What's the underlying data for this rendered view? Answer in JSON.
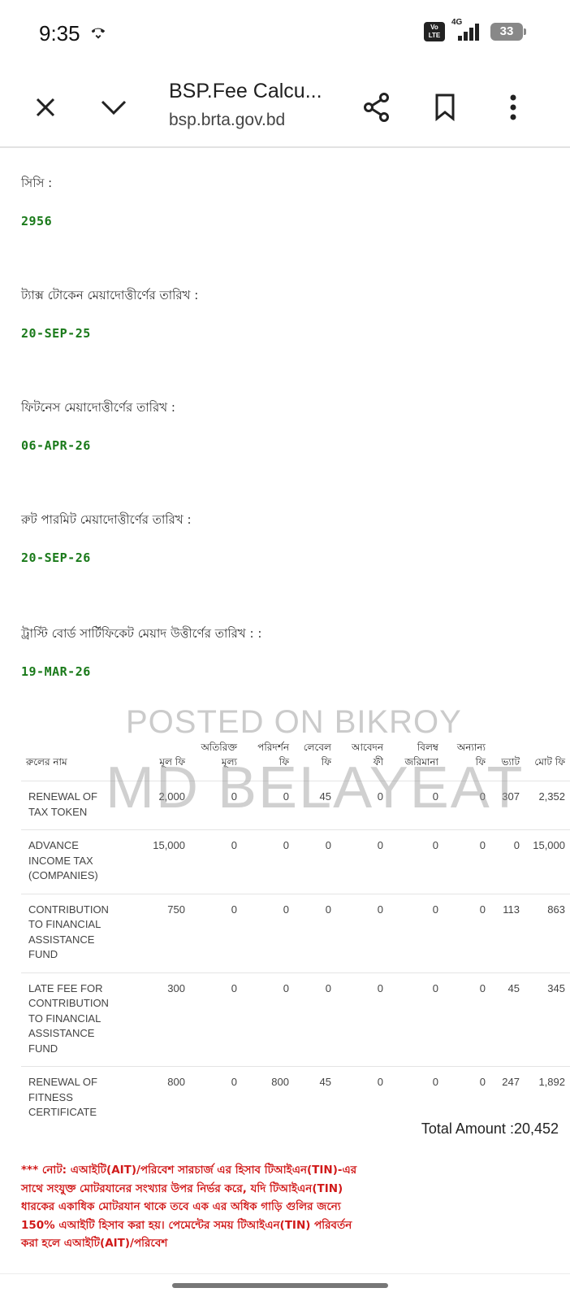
{
  "status_bar": {
    "time": "9:35",
    "volte": "Vo LTE",
    "network": "4G",
    "battery": "33"
  },
  "browser": {
    "title": "BSP.Fee Calcu...",
    "url": "bsp.brta.gov.bd"
  },
  "fields": [
    {
      "label": "সিসি :",
      "value": "2956"
    },
    {
      "label": "ট্যাক্স টোকেন মেয়াদোত্তীর্ণের তারিখ :",
      "value": "20-SEP-25"
    },
    {
      "label": "ফিটনেস মেয়াদোত্তীর্ণের তারিখ :",
      "value": "06-APR-26"
    },
    {
      "label": "রুট পারমিট মেয়াদোত্তীর্ণের তারিখ :",
      "value": "20-SEP-26"
    },
    {
      "label": "ট্রাস্টি বোর্ড সার্টিফিকেট মেয়াদ উত্তীর্ণের তারিখ : :",
      "value": "19-MAR-26"
    }
  ],
  "watermark": {
    "line1": "POSTED ON BIKROY",
    "line2": "MD BELAYEAT"
  },
  "table": {
    "headers": [
      "রুলের নাম",
      "মূল ফি",
      "অতিরিক্ত মূল্য",
      "পরিদর্শন ফি",
      "লেবেল ফি",
      "আবেদন ফী",
      "বিলম্ব জরিমানা",
      "অন্যান্য ফি",
      "ভ্যাট",
      "মোট ফি"
    ],
    "rows": [
      [
        "RENEWAL OF TAX TOKEN",
        "2,000",
        "0",
        "0",
        "45",
        "0",
        "0",
        "0",
        "307",
        "2,352"
      ],
      [
        "ADVANCE INCOME TAX (COMPANIES)",
        "15,000",
        "0",
        "0",
        "0",
        "0",
        "0",
        "0",
        "0",
        "15,000"
      ],
      [
        "CONTRIBUTION TO FINANCIAL ASSISTANCE FUND",
        "750",
        "0",
        "0",
        "0",
        "0",
        "0",
        "0",
        "113",
        "863"
      ],
      [
        "LATE FEE FOR CONTRIBUTION TO FINANCIAL ASSISTANCE FUND",
        "300",
        "0",
        "0",
        "0",
        "0",
        "0",
        "0",
        "45",
        "345"
      ],
      [
        "RENEWAL OF FITNESS CERTIFICATE",
        "800",
        "0",
        "800",
        "45",
        "0",
        "0",
        "0",
        "247",
        "1,892"
      ]
    ]
  },
  "total": "Total Amount :20,452",
  "note": "*** নোট: এআইটি(AIT)/পরিবেশ সারচার্জ এর হিসাব টিআইএন(TIN)-এর সাথে সংযুক্ত মোটরযানের সংখ্যার উপর নির্ভর করে, যদি টিআইএন(TIN) ধারকের একাধিক মোটরযান থাকে তবে এক এর অধিক গাড়ি গুলির জন্যে 150% এআইটি হিসাব করা হয়। পেমেন্টের সময় টিআইএন(TIN) পরিবর্তন করা হলে এআইটি(AIT)/পরিবেশ"
}
